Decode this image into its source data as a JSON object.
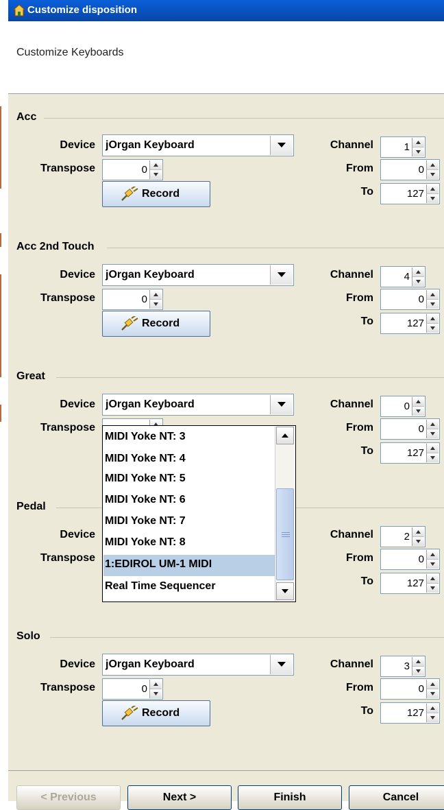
{
  "window": {
    "title": "Customize disposition",
    "icon": "home-icon"
  },
  "header": {
    "description": "Customize Keyboards"
  },
  "labels": {
    "device": "Device",
    "transpose": "Transpose",
    "channel": "Channel",
    "from": "From",
    "to": "To",
    "record": "Record"
  },
  "sections": [
    {
      "title": "Acc",
      "device": "jOrgan Keyboard",
      "transpose": "0",
      "channel": "1",
      "from": "0",
      "to": "127"
    },
    {
      "title": "Acc 2nd Touch",
      "device": "jOrgan Keyboard",
      "transpose": "0",
      "channel": "4",
      "from": "0",
      "to": "127"
    },
    {
      "title": "Great",
      "device": "jOrgan Keyboard",
      "transpose": "",
      "channel": "0",
      "from": "0",
      "to": "127"
    },
    {
      "title": "Pedal",
      "device": "",
      "transpose": "",
      "channel": "2",
      "from": "0",
      "to": "127"
    },
    {
      "title": "Solo",
      "device": "jOrgan Keyboard",
      "transpose": "0",
      "channel": "3",
      "from": "0",
      "to": "127"
    }
  ],
  "dropdown": {
    "items": [
      "MIDI Yoke NT:  3",
      "MIDI Yoke NT:  4",
      "MIDI Yoke NT:  5",
      "MIDI Yoke NT:  6",
      "MIDI Yoke NT:  7",
      "MIDI Yoke NT:  8",
      "1:EDIROL UM-1 MIDI",
      "Real Time Sequencer"
    ],
    "selected": "1:EDIROL UM-1 MIDI"
  },
  "footer": {
    "previous": "< Previous",
    "next": "Next >",
    "finish": "Finish",
    "cancel": "Cancel"
  },
  "colors": {
    "titlebar": "#0a5fd9",
    "selection": "#b8cfe5",
    "panel": "#ece9d8"
  }
}
